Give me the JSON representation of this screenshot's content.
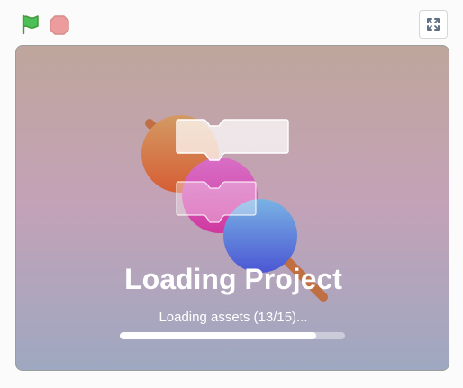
{
  "toolbar": {
    "icons": {
      "flag": "green-flag-icon",
      "stop": "stop-sign-icon",
      "fullscreen": "fullscreen-icon"
    }
  },
  "stage": {
    "loading_title": "Loading Project",
    "loading_status": "Loading assets (13/15)...",
    "progress": 0.87
  },
  "colors": {
    "flag": "#4cbf56",
    "stop": "#ec9c9c",
    "progress_fill": "#ffffff"
  }
}
